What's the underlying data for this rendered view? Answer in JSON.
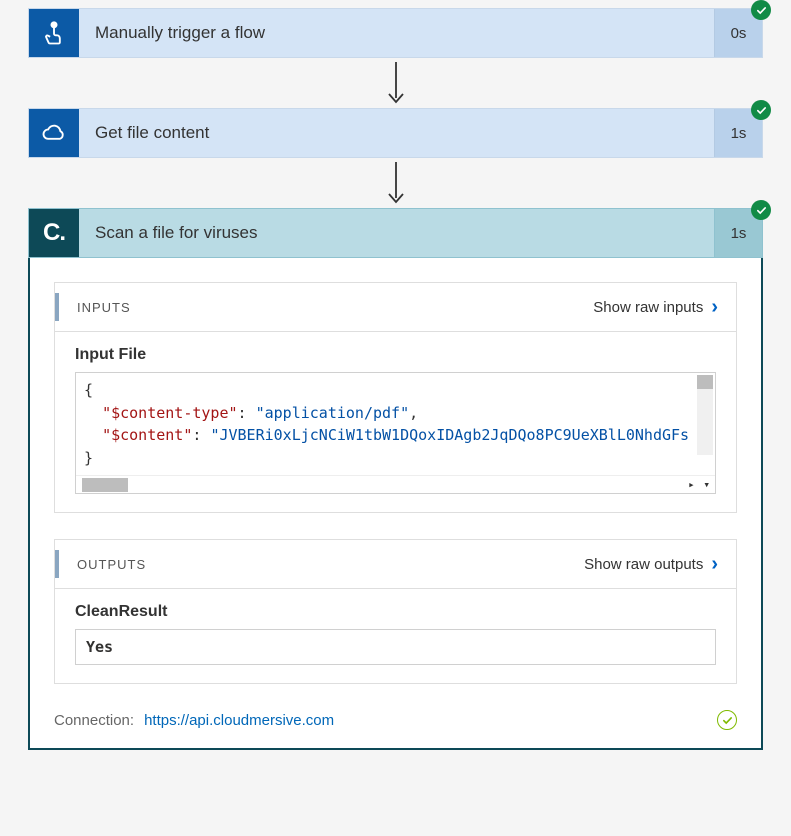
{
  "steps": {
    "trigger": {
      "title": "Manually trigger a flow",
      "duration": "0s"
    },
    "getfile": {
      "title": "Get file content",
      "duration": "1s"
    },
    "scan": {
      "title": "Scan a file for viruses",
      "duration": "1s",
      "icon_letter": "C."
    }
  },
  "inputs": {
    "section_label": "INPUTS",
    "show_label": "Show raw inputs",
    "field_label": "Input File",
    "json_keys": {
      "content_type": "\"$content-type\"",
      "content": "\"$content\""
    },
    "json_values": {
      "content_type": "\"application/pdf\"",
      "content": "\"JVBERi0xLjcNCiW1tbW1DQoxIDAgb2JqDQo8PC9UeXBlL0NhdGFs"
    }
  },
  "outputs": {
    "section_label": "OUTPUTS",
    "show_label": "Show raw outputs",
    "field_label": "CleanResult",
    "value": "Yes"
  },
  "connection": {
    "label": "Connection:",
    "url": "https://api.cloudmersive.com"
  }
}
